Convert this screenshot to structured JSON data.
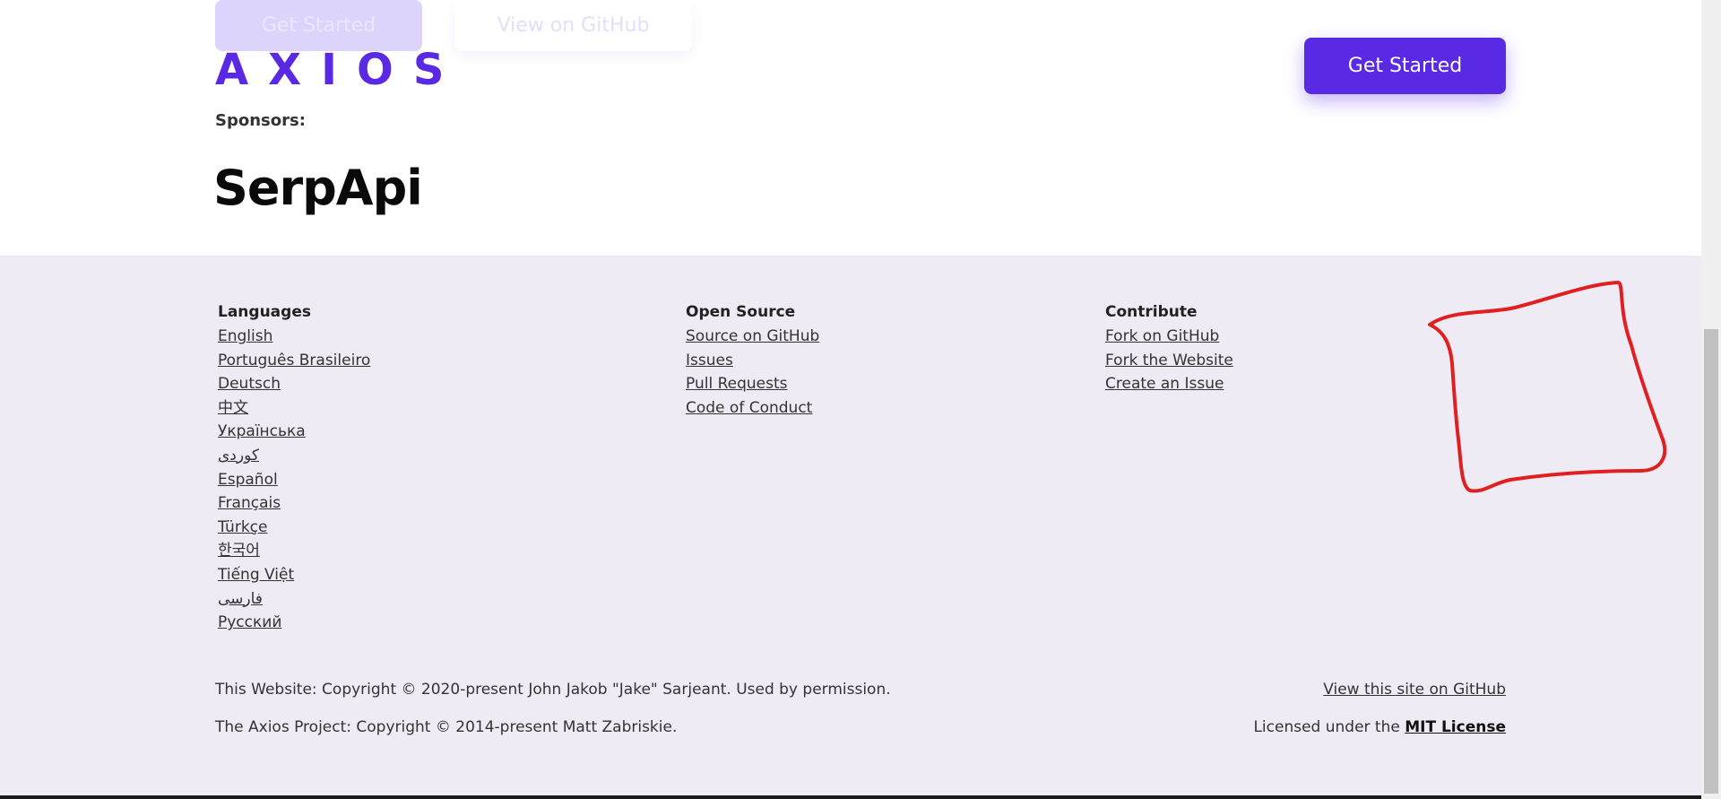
{
  "header": {
    "ghost_buttons": [
      "Get Started",
      "View on GitHub"
    ],
    "logo_text": "AXIOS",
    "get_started_label": "Get Started",
    "sponsors_label": "Sponsors:",
    "sponsor_name": "SerpApi",
    "accent_color": "#5a29e4"
  },
  "footer": {
    "languages": {
      "heading": "Languages",
      "links": [
        "English",
        "Português Brasileiro",
        "Deutsch",
        "中文",
        "Українська",
        "کوردی",
        "Español",
        "Français",
        "Türkçe",
        "한국어",
        "Tiếng Việt",
        "فارسی",
        "Русский"
      ]
    },
    "open_source": {
      "heading": "Open Source",
      "links": [
        "Source on GitHub",
        "Issues",
        "Pull Requests",
        "Code of Conduct"
      ]
    },
    "contribute": {
      "heading": "Contribute",
      "links": [
        "Fork on GitHub",
        "Fork the Website",
        "Create an Issue"
      ]
    },
    "copyright_website": "This Website: Copyright © 2020-present John Jakob \"Jake\" Sarjeant. Used by permission.",
    "copyright_project": "The Axios Project: Copyright © 2014-present Matt Zabriskie.",
    "github_link": "View this site on GitHub",
    "license_prefix": "Licensed under the ",
    "license_link": "MIT License"
  },
  "annotation": {
    "color": "#e02020",
    "shape": "hand-drawn-loop"
  }
}
